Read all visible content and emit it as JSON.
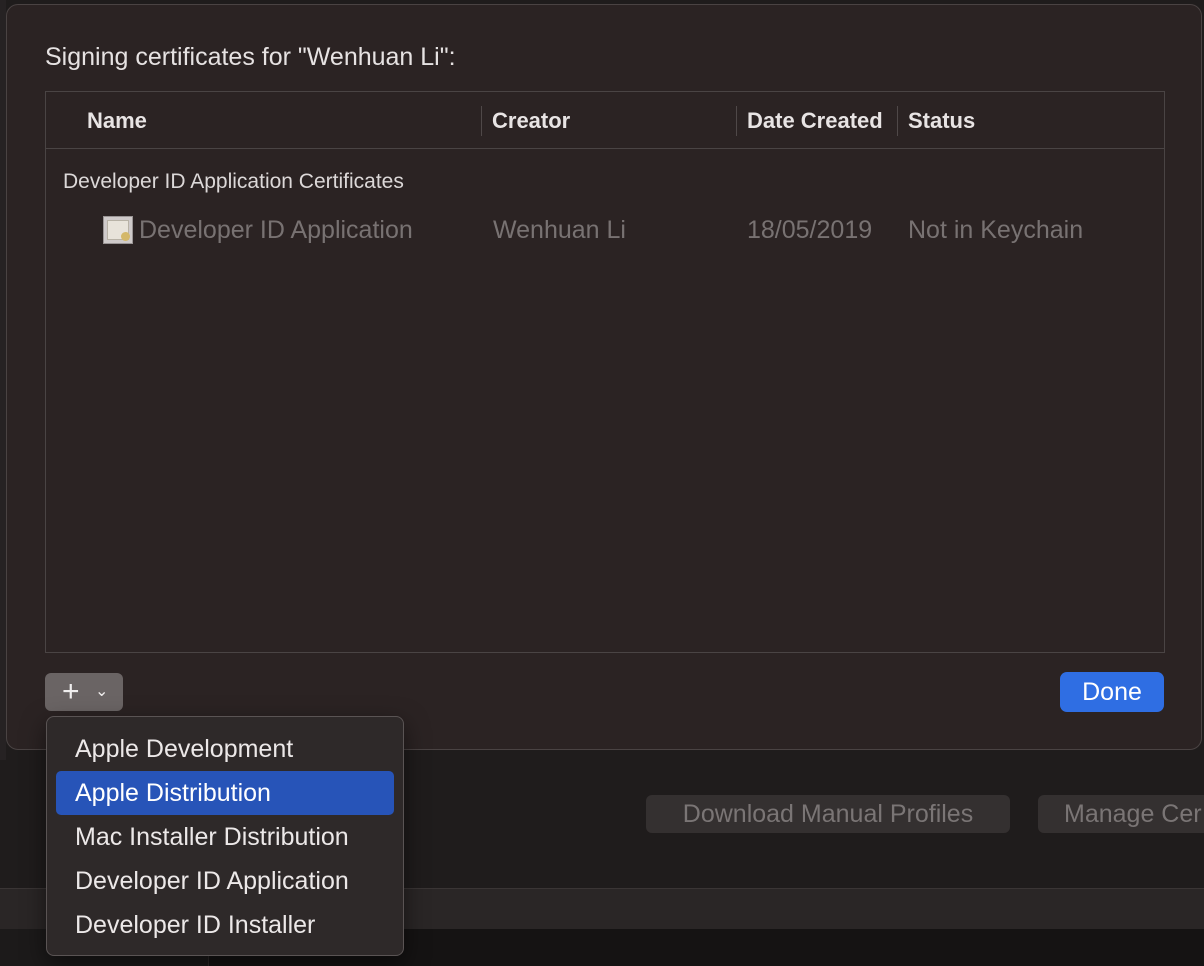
{
  "background": {
    "buttons": [
      {
        "label": "Download Manual Profiles"
      },
      {
        "label": "Manage Cer"
      }
    ]
  },
  "sheet": {
    "title": "Signing certificates for \"Wenhuan Li\":",
    "table": {
      "columns": [
        "Name",
        "Creator",
        "Date Created",
        "Status"
      ],
      "groups": [
        {
          "label": "Developer ID Application Certificates",
          "rows": [
            {
              "icon": "certificate-icon",
              "name": "Developer ID Application",
              "creator": "Wenhuan Li",
              "date_created": "18/05/2019",
              "status": "Not in Keychain"
            }
          ]
        }
      ]
    },
    "add_button": {
      "plus": "+",
      "chevron": "⌄",
      "icon": "plus-icon"
    },
    "done_button": {
      "label": "Done",
      "color": "#2f6ee3"
    }
  },
  "add_menu": {
    "items": [
      {
        "label": "Apple Development",
        "selected": false
      },
      {
        "label": "Apple Distribution",
        "selected": true
      },
      {
        "label": "Mac Installer Distribution",
        "selected": false
      },
      {
        "label": "Developer ID Application",
        "selected": false
      },
      {
        "label": "Developer ID Installer",
        "selected": false
      }
    ],
    "selected_color": "#2754b8"
  }
}
